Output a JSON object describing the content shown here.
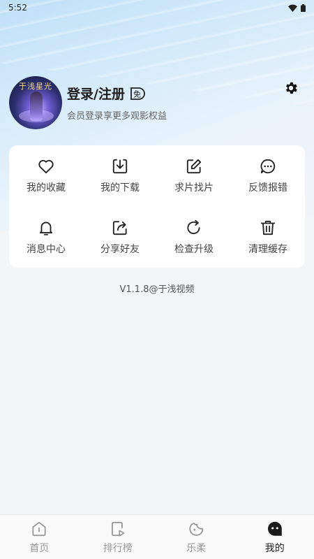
{
  "status_bar": {
    "time": "5:52"
  },
  "profile": {
    "login_title": "登录/注册",
    "subtitle": "会员登录享更多观影权益",
    "vip_badge_text": "免",
    "avatar_title": "于浅星光"
  },
  "menu": {
    "items": [
      {
        "label": "我的收藏",
        "icon": "heart-icon"
      },
      {
        "label": "我的下载",
        "icon": "download-icon"
      },
      {
        "label": "求片找片",
        "icon": "edit-icon"
      },
      {
        "label": "反馈报错",
        "icon": "chat-icon"
      },
      {
        "label": "消息中心",
        "icon": "bell-icon"
      },
      {
        "label": "分享好友",
        "icon": "share-icon"
      },
      {
        "label": "检查升级",
        "icon": "refresh-icon"
      },
      {
        "label": "清理缓存",
        "icon": "trash-icon"
      }
    ]
  },
  "version": "V1.1.8@于浅视频",
  "tabbar": {
    "items": [
      {
        "label": "首页",
        "icon": "home-icon",
        "active": false
      },
      {
        "label": "排行榜",
        "icon": "ranking-icon",
        "active": false
      },
      {
        "label": "乐柔",
        "icon": "leaf-icon",
        "active": false
      },
      {
        "label": "我的",
        "icon": "profile-icon",
        "active": true
      }
    ]
  },
  "colors": {
    "accent": "#1e1e1e",
    "muted": "#999999",
    "card": "#ffffff",
    "background": "#f4f5f7"
  }
}
